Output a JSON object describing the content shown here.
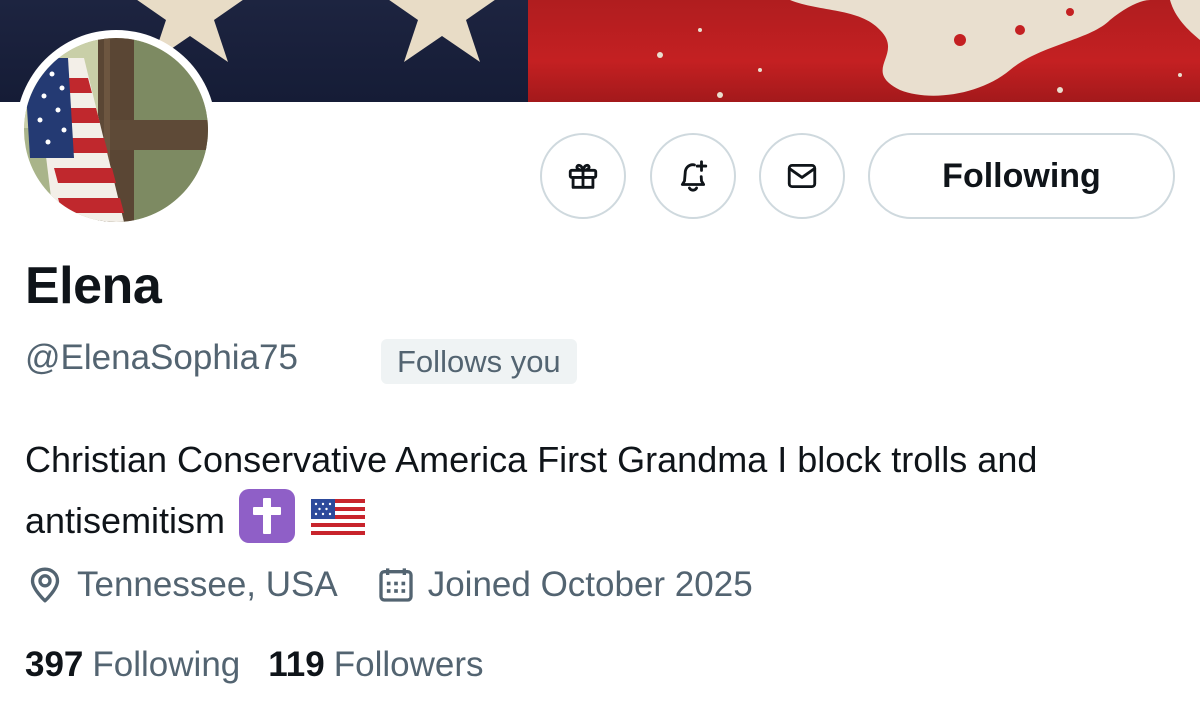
{
  "profile": {
    "display_name": "Elena",
    "handle": "@ElenaSophia75",
    "follows_you_badge": "Follows you",
    "bio_text": "Christian Conservative America First Grandma I block trolls and antisemitism",
    "bio_emojis": [
      "latin-cross-emoji",
      "us-flag-emoji"
    ],
    "location": "Tennessee, USA",
    "joined": "Joined October 2025"
  },
  "actions": {
    "gift_icon": "gift-icon",
    "notify_icon": "bell-plus-icon",
    "message_icon": "envelope-icon",
    "follow_label": "Following"
  },
  "stats": {
    "following_count": "397",
    "following_label": "Following",
    "followers_count": "119",
    "followers_label": "Followers"
  },
  "colors": {
    "text_primary": "#0f1419",
    "text_secondary": "#536471",
    "border": "#cfd9de",
    "badge_bg": "#eff3f4",
    "banner_blue": "#1d2440",
    "banner_red": "#b01d1f"
  }
}
